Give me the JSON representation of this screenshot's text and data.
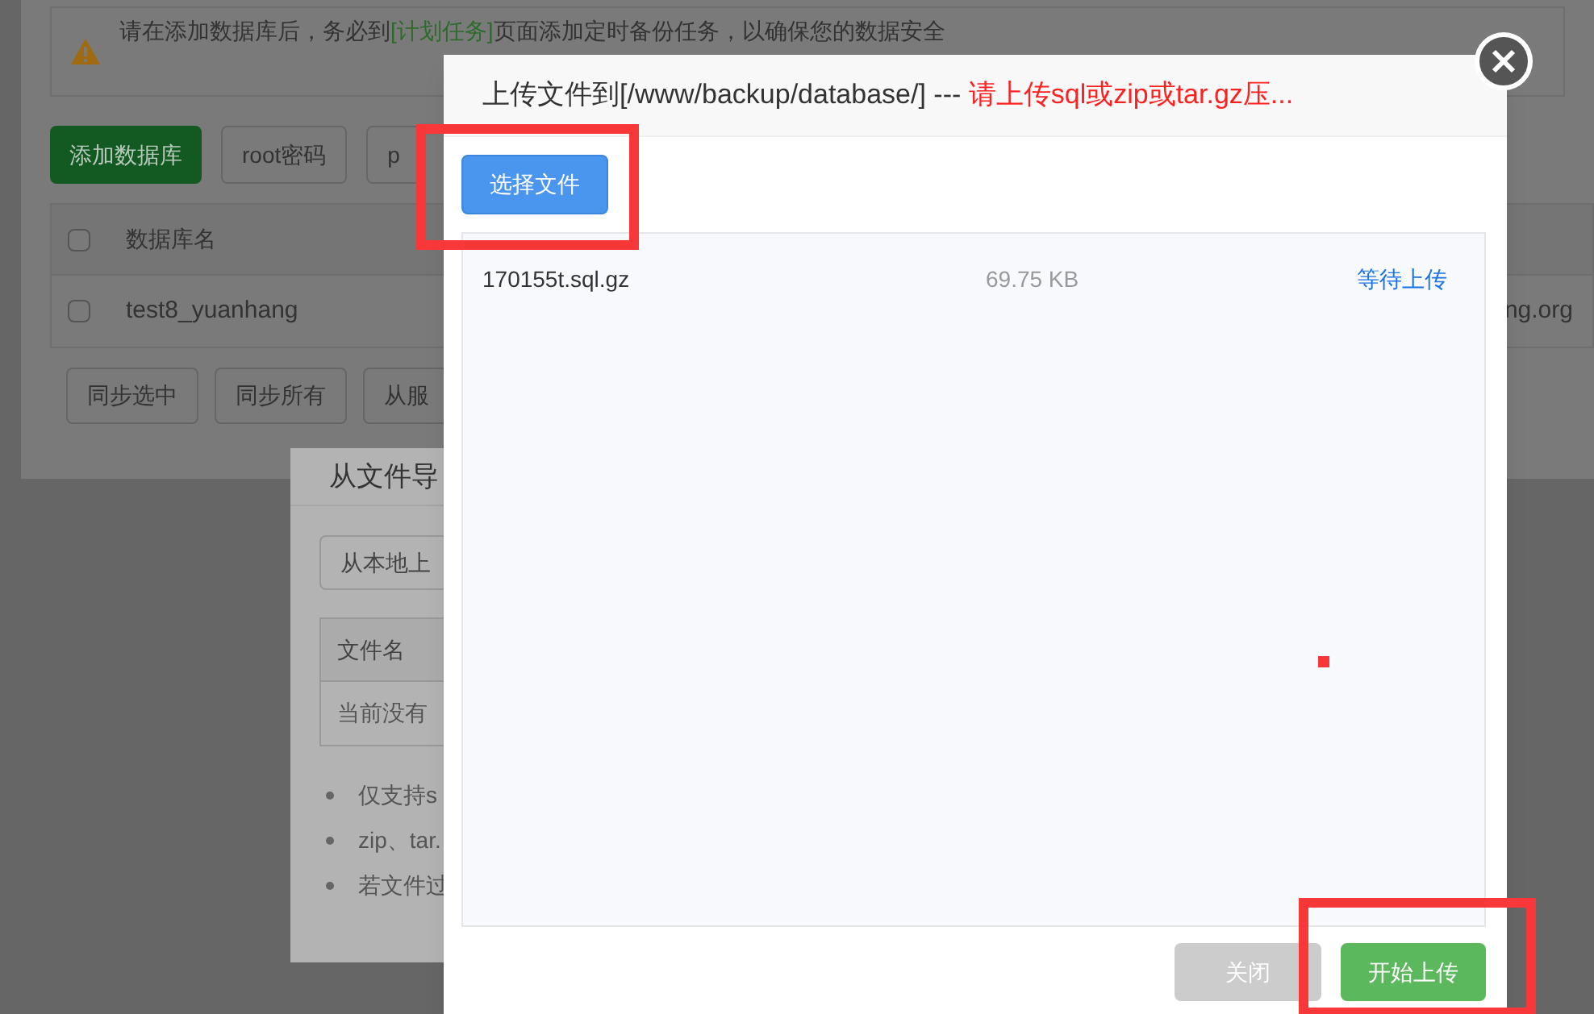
{
  "background_page": {
    "notice": {
      "before": "请在添加数据库后，务必到",
      "link": "[计划任务]",
      "after": "页面添加定时备份任务，以确保您的数据安全"
    },
    "toolbar": [
      {
        "label": "添加数据库",
        "kind": "primary"
      },
      {
        "label": "root密码",
        "kind": "default"
      },
      {
        "label": "p",
        "kind": "default"
      }
    ],
    "table": {
      "select_all_checked": false,
      "columns": [
        "数据库名"
      ],
      "rows": [
        {
          "checked": false,
          "name": "test8_yuanhang",
          "column_2": "ng.org"
        }
      ]
    },
    "actions": [
      "同步选中",
      "同步所有",
      "从服"
    ]
  },
  "import_dialog": {
    "title": "从文件导",
    "upload_button": "从本地上",
    "table": {
      "columns": [
        "文件名"
      ],
      "empty": "当前没有"
    },
    "notes": [
      "仅支持s",
      "zip、tar.",
      "若文件过"
    ]
  },
  "upload_dialog": {
    "title": "上传文件到[/www/backup/database/] --- ",
    "warning": "请上传sql或zip或tar.gz压...",
    "choose_button": "选择文件",
    "files": [
      {
        "name": "170155t.sql.gz",
        "size": "69.75 KB",
        "status": "等待上传"
      }
    ],
    "buttons": [
      {
        "label": "关闭",
        "kind": "secondary"
      },
      {
        "label": "开始上传",
        "kind": "primary"
      }
    ]
  }
}
